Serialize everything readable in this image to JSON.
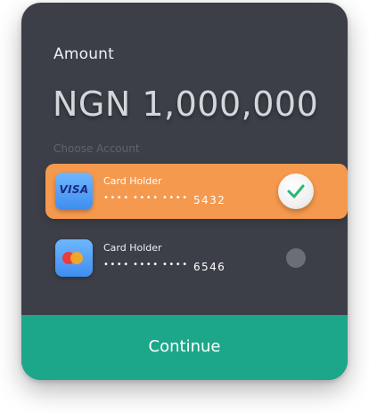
{
  "amount": {
    "label": "Amount",
    "value": "NGN 1,000,000"
  },
  "choose_account_label": "Choose Account",
  "accounts": [
    {
      "brand_icon": "visa-card-icon",
      "brand_text": "VISA",
      "holder": "Card Holder",
      "masked_groups": [
        "••••",
        "••••",
        "••••"
      ],
      "last4": "5432",
      "selected": true
    },
    {
      "brand_icon": "mastercard-icon",
      "holder": "Card Holder",
      "masked_groups": [
        "••••",
        "••••",
        "••••"
      ],
      "last4": "6546",
      "selected": false
    }
  ],
  "continue_label": "Continue",
  "colors": {
    "panel_bg": "#3c3f47",
    "selected_card": "#f5994e",
    "continue_bg": "#1da78a",
    "check_green": "#2bb673"
  }
}
